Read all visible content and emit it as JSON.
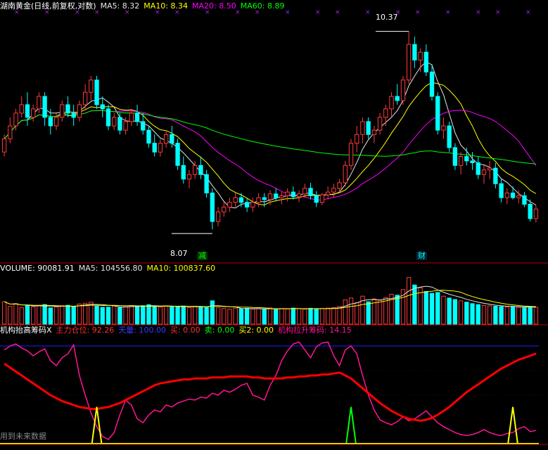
{
  "colors": {
    "up": "#ff3c3c",
    "down": "#00ffff",
    "ma5": "#e6e6e6",
    "ma10": "#ffff00",
    "ma20": "#ff00ff",
    "ma60": "#00ff00",
    "main_force": "#ff0000",
    "pull_up": "#ff1493",
    "buy2": "#ffff00",
    "sell": "#00ff00",
    "ceiling": "#1e1eff",
    "separator": "#b40000"
  },
  "price_panel": {
    "title": "湖南黄金(日线,前复权,对数)",
    "ma5": "MA5: 8.32",
    "ma10": "MA10: 8.34",
    "ma20": "MA20: 8.50",
    "ma60": "MA60: 8.89",
    "high_label": "10.37",
    "low_label": "8.07",
    "tag_reduce": "减",
    "tag_fin": "财"
  },
  "volume_panel": {
    "title": "VOLUME: 90081.91",
    "ma5": "MA5: 104556.80",
    "ma10": "MA10: 100837.60"
  },
  "indicator_panel": {
    "title": "机构抬高筹码X",
    "main_force": "主力仓位: 92.26",
    "ceiling": "天量: 100.00",
    "buy": "买: 0.00",
    "sell": "卖: 0.00",
    "buy2": "买2: 0.00",
    "pull_up": "机构拉升筹码: 14.15",
    "footer": "用到未来数据"
  },
  "chart_data": [
    {
      "type": "candlestick",
      "title": "湖南黄金(日线,前复权,对数)",
      "scale": "log",
      "ylim": [
        7.9,
        10.6
      ],
      "candles": [
        [
          8.9,
          9.1,
          8.85,
          9.05
        ],
        [
          9.05,
          9.3,
          9.0,
          9.2
        ],
        [
          9.2,
          9.4,
          9.15,
          9.35
        ],
        [
          9.35,
          9.55,
          9.3,
          9.45
        ],
        [
          9.45,
          9.6,
          9.2,
          9.3
        ],
        [
          9.3,
          9.45,
          9.25,
          9.4
        ],
        [
          9.4,
          9.6,
          9.35,
          9.55
        ],
        [
          9.55,
          9.6,
          9.2,
          9.3
        ],
        [
          9.3,
          9.4,
          9.1,
          9.2
        ],
        [
          9.2,
          9.35,
          9.15,
          9.3
        ],
        [
          9.3,
          9.5,
          9.25,
          9.45
        ],
        [
          9.45,
          9.55,
          9.3,
          9.35
        ],
        [
          9.35,
          9.45,
          9.2,
          9.3
        ],
        [
          9.3,
          9.5,
          9.25,
          9.45
        ],
        [
          9.45,
          9.7,
          9.4,
          9.6
        ],
        [
          9.6,
          9.8,
          9.5,
          9.75
        ],
        [
          9.75,
          9.8,
          9.4,
          9.45
        ],
        [
          9.45,
          9.55,
          9.3,
          9.4
        ],
        [
          9.4,
          9.45,
          9.15,
          9.2
        ],
        [
          9.2,
          9.35,
          9.15,
          9.3
        ],
        [
          9.3,
          9.35,
          9.1,
          9.15
        ],
        [
          9.15,
          9.3,
          9.1,
          9.25
        ],
        [
          9.25,
          9.4,
          9.2,
          9.35
        ],
        [
          9.35,
          9.45,
          9.2,
          9.25
        ],
        [
          9.25,
          9.35,
          9.1,
          9.15
        ],
        [
          9.15,
          9.2,
          8.95,
          9.0
        ],
        [
          9.0,
          9.1,
          8.85,
          8.9
        ],
        [
          8.9,
          9.05,
          8.85,
          9.0
        ],
        [
          9.0,
          9.15,
          8.95,
          9.1
        ],
        [
          9.1,
          9.2,
          8.95,
          9.0
        ],
        [
          9.0,
          9.05,
          8.7,
          8.75
        ],
        [
          8.75,
          8.85,
          8.55,
          8.6
        ],
        [
          8.6,
          8.7,
          8.5,
          8.65
        ],
        [
          8.65,
          8.8,
          8.6,
          8.75
        ],
        [
          8.75,
          8.85,
          8.6,
          8.65
        ],
        [
          8.65,
          8.7,
          8.4,
          8.45
        ],
        [
          8.45,
          8.5,
          8.07,
          8.15
        ],
        [
          8.15,
          8.3,
          8.1,
          8.25
        ],
        [
          8.25,
          8.35,
          8.2,
          8.3
        ],
        [
          8.3,
          8.4,
          8.25,
          8.35
        ],
        [
          8.35,
          8.45,
          8.3,
          8.4
        ],
        [
          8.4,
          8.45,
          8.3,
          8.35
        ],
        [
          8.35,
          8.4,
          8.25,
          8.3
        ],
        [
          8.3,
          8.4,
          8.25,
          8.35
        ],
        [
          8.35,
          8.45,
          8.3,
          8.4
        ],
        [
          8.4,
          8.45,
          8.3,
          8.38
        ],
        [
          8.38,
          8.48,
          8.32,
          8.44
        ],
        [
          8.44,
          8.5,
          8.36,
          8.4
        ],
        [
          8.4,
          8.46,
          8.33,
          8.42
        ],
        [
          8.42,
          8.5,
          8.36,
          8.46
        ],
        [
          8.46,
          8.52,
          8.38,
          8.41
        ],
        [
          8.41,
          8.48,
          8.35,
          8.44
        ],
        [
          8.44,
          8.55,
          8.4,
          8.5
        ],
        [
          8.5,
          8.56,
          8.38,
          8.42
        ],
        [
          8.42,
          8.47,
          8.3,
          8.35
        ],
        [
          8.35,
          8.45,
          8.32,
          8.43
        ],
        [
          8.43,
          8.52,
          8.38,
          8.46
        ],
        [
          8.46,
          8.55,
          8.4,
          8.5
        ],
        [
          8.5,
          8.6,
          8.45,
          8.56
        ],
        [
          8.56,
          8.8,
          8.52,
          8.75
        ],
        [
          8.75,
          9.05,
          8.7,
          9.0
        ],
        [
          9.0,
          9.2,
          8.9,
          9.1
        ],
        [
          9.1,
          9.3,
          9.0,
          9.25
        ],
        [
          9.25,
          9.3,
          9.05,
          9.1
        ],
        [
          9.1,
          9.2,
          9.0,
          9.15
        ],
        [
          9.15,
          9.35,
          9.1,
          9.3
        ],
        [
          9.3,
          9.45,
          9.2,
          9.4
        ],
        [
          9.4,
          9.6,
          9.3,
          9.55
        ],
        [
          9.55,
          9.7,
          9.45,
          9.5
        ],
        [
          9.5,
          9.8,
          9.45,
          9.75
        ],
        [
          9.75,
          10.37,
          9.7,
          10.2
        ],
        [
          10.2,
          10.3,
          9.9,
          10.0
        ],
        [
          10.0,
          10.15,
          9.85,
          10.1
        ],
        [
          10.1,
          10.2,
          9.8,
          9.85
        ],
        [
          9.85,
          9.95,
          9.5,
          9.55
        ],
        [
          9.55,
          9.6,
          9.1,
          9.15
        ],
        [
          9.15,
          9.3,
          9.05,
          9.2
        ],
        [
          9.2,
          9.25,
          8.9,
          8.95
        ],
        [
          8.95,
          9.0,
          8.7,
          8.75
        ],
        [
          8.75,
          8.9,
          8.65,
          8.85
        ],
        [
          8.85,
          8.95,
          8.75,
          8.8
        ],
        [
          8.8,
          8.9,
          8.7,
          8.78
        ],
        [
          8.78,
          8.85,
          8.6,
          8.65
        ],
        [
          8.65,
          8.75,
          8.55,
          8.7
        ],
        [
          8.7,
          8.8,
          8.6,
          8.72
        ],
        [
          8.72,
          8.78,
          8.5,
          8.55
        ],
        [
          8.55,
          8.6,
          8.35,
          8.4
        ],
        [
          8.4,
          8.5,
          8.33,
          8.45
        ],
        [
          8.45,
          8.52,
          8.38,
          8.4
        ],
        [
          8.4,
          8.48,
          8.34,
          8.42
        ],
        [
          8.42,
          8.46,
          8.3,
          8.33
        ],
        [
          8.33,
          8.38,
          8.15,
          8.18
        ],
        [
          8.18,
          8.32,
          8.14,
          8.28
        ]
      ],
      "high_label": 10.37,
      "low_label": 8.07,
      "series": [
        {
          "name": "MA5",
          "last": 8.32
        },
        {
          "name": "MA10",
          "last": 8.34
        },
        {
          "name": "MA20",
          "last": 8.5
        },
        {
          "name": "MA60",
          "last": 8.89
        }
      ]
    },
    {
      "type": "bar",
      "title": "VOLUME",
      "ylim": [
        0,
        260000
      ],
      "values": [
        120000,
        95000,
        110000,
        88000,
        102000,
        93000,
        98000,
        105000,
        87000,
        92000,
        99000,
        101000,
        94000,
        108000,
        112000,
        118000,
        96000,
        90000,
        91000,
        97000,
        89000,
        93000,
        100000,
        95000,
        99000,
        104000,
        96000,
        92000,
        98000,
        94000,
        91000,
        97000,
        89000,
        95000,
        93000,
        90000,
        125000,
        88000,
        84000,
        80000,
        86000,
        82000,
        85000,
        81000,
        83000,
        79000,
        87000,
        82000,
        84000,
        81000,
        86000,
        83000,
        80000,
        85000,
        82000,
        84000,
        86000,
        88000,
        95000,
        130000,
        140000,
        115000,
        150000,
        120000,
        135000,
        128000,
        142000,
        160000,
        155000,
        185000,
        250000,
        210000,
        195000,
        175000,
        165000,
        170000,
        150000,
        140000,
        132000,
        125000,
        118000,
        110000,
        105000,
        100000,
        98000,
        96000,
        94000,
        92000,
        95000,
        91000,
        88000,
        93000,
        90082
      ],
      "series": [
        {
          "name": "MA5",
          "last": 104556.8
        },
        {
          "name": "MA10",
          "last": 100837.6
        }
      ]
    },
    {
      "type": "line",
      "title": "机构抬高筹码X",
      "ylim": [
        0,
        110
      ],
      "series": [
        {
          "name": "主力仓位",
          "last": 92.26,
          "values": [
            82,
            78,
            74,
            70,
            66,
            62,
            58,
            54,
            50,
            47,
            44,
            42,
            40,
            38,
            37,
            36,
            36,
            37,
            38,
            40,
            42,
            45,
            48,
            51,
            54,
            57,
            60,
            62,
            63,
            64,
            65,
            66,
            66,
            67,
            67,
            67,
            68,
            68,
            68,
            69,
            69,
            69,
            69,
            68,
            68,
            67,
            67,
            67,
            67,
            68,
            68,
            69,
            69,
            70,
            70,
            71,
            71,
            72,
            73,
            70,
            67,
            62,
            57,
            52,
            47,
            42,
            38,
            34,
            31,
            28,
            26,
            25,
            24,
            25,
            27,
            30,
            34,
            38,
            43,
            48,
            53,
            57,
            61,
            65,
            69,
            73,
            77,
            80,
            83,
            86,
            88,
            90,
            92.26
          ]
        },
        {
          "name": "机构拉升筹码",
          "last": 14.15,
          "values": [
            96,
            100,
            102,
            98,
            95,
            90,
            94,
            97,
            85,
            80,
            88,
            92,
            101,
            70,
            50,
            32,
            18,
            8,
            5,
            12,
            30,
            45,
            40,
            26,
            22,
            30,
            35,
            33,
            40,
            38,
            42,
            44,
            46,
            45,
            48,
            47,
            52,
            50,
            55,
            53,
            56,
            60,
            62,
            50,
            48,
            45,
            60,
            70,
            85,
            95,
            102,
            104,
            96,
            88,
            99,
            103,
            104,
            90,
            80,
            96,
            100,
            92,
            70,
            50,
            35,
            25,
            22,
            20,
            23,
            28,
            24,
            26,
            30,
            34,
            28,
            22,
            18,
            15,
            12,
            10,
            9,
            10,
            12,
            15,
            12,
            10,
            9,
            11,
            12,
            16,
            18,
            13,
            14.15
          ]
        },
        {
          "name": "天量",
          "last": 100.0
        },
        {
          "name": "买",
          "last": 0.0
        },
        {
          "name": "卖",
          "last": 0.0
        },
        {
          "name": "买2",
          "last": 0.0
        }
      ],
      "spikes_buy2_at": [
        16,
        88
      ],
      "spikes_sell_at": [
        60
      ]
    }
  ]
}
